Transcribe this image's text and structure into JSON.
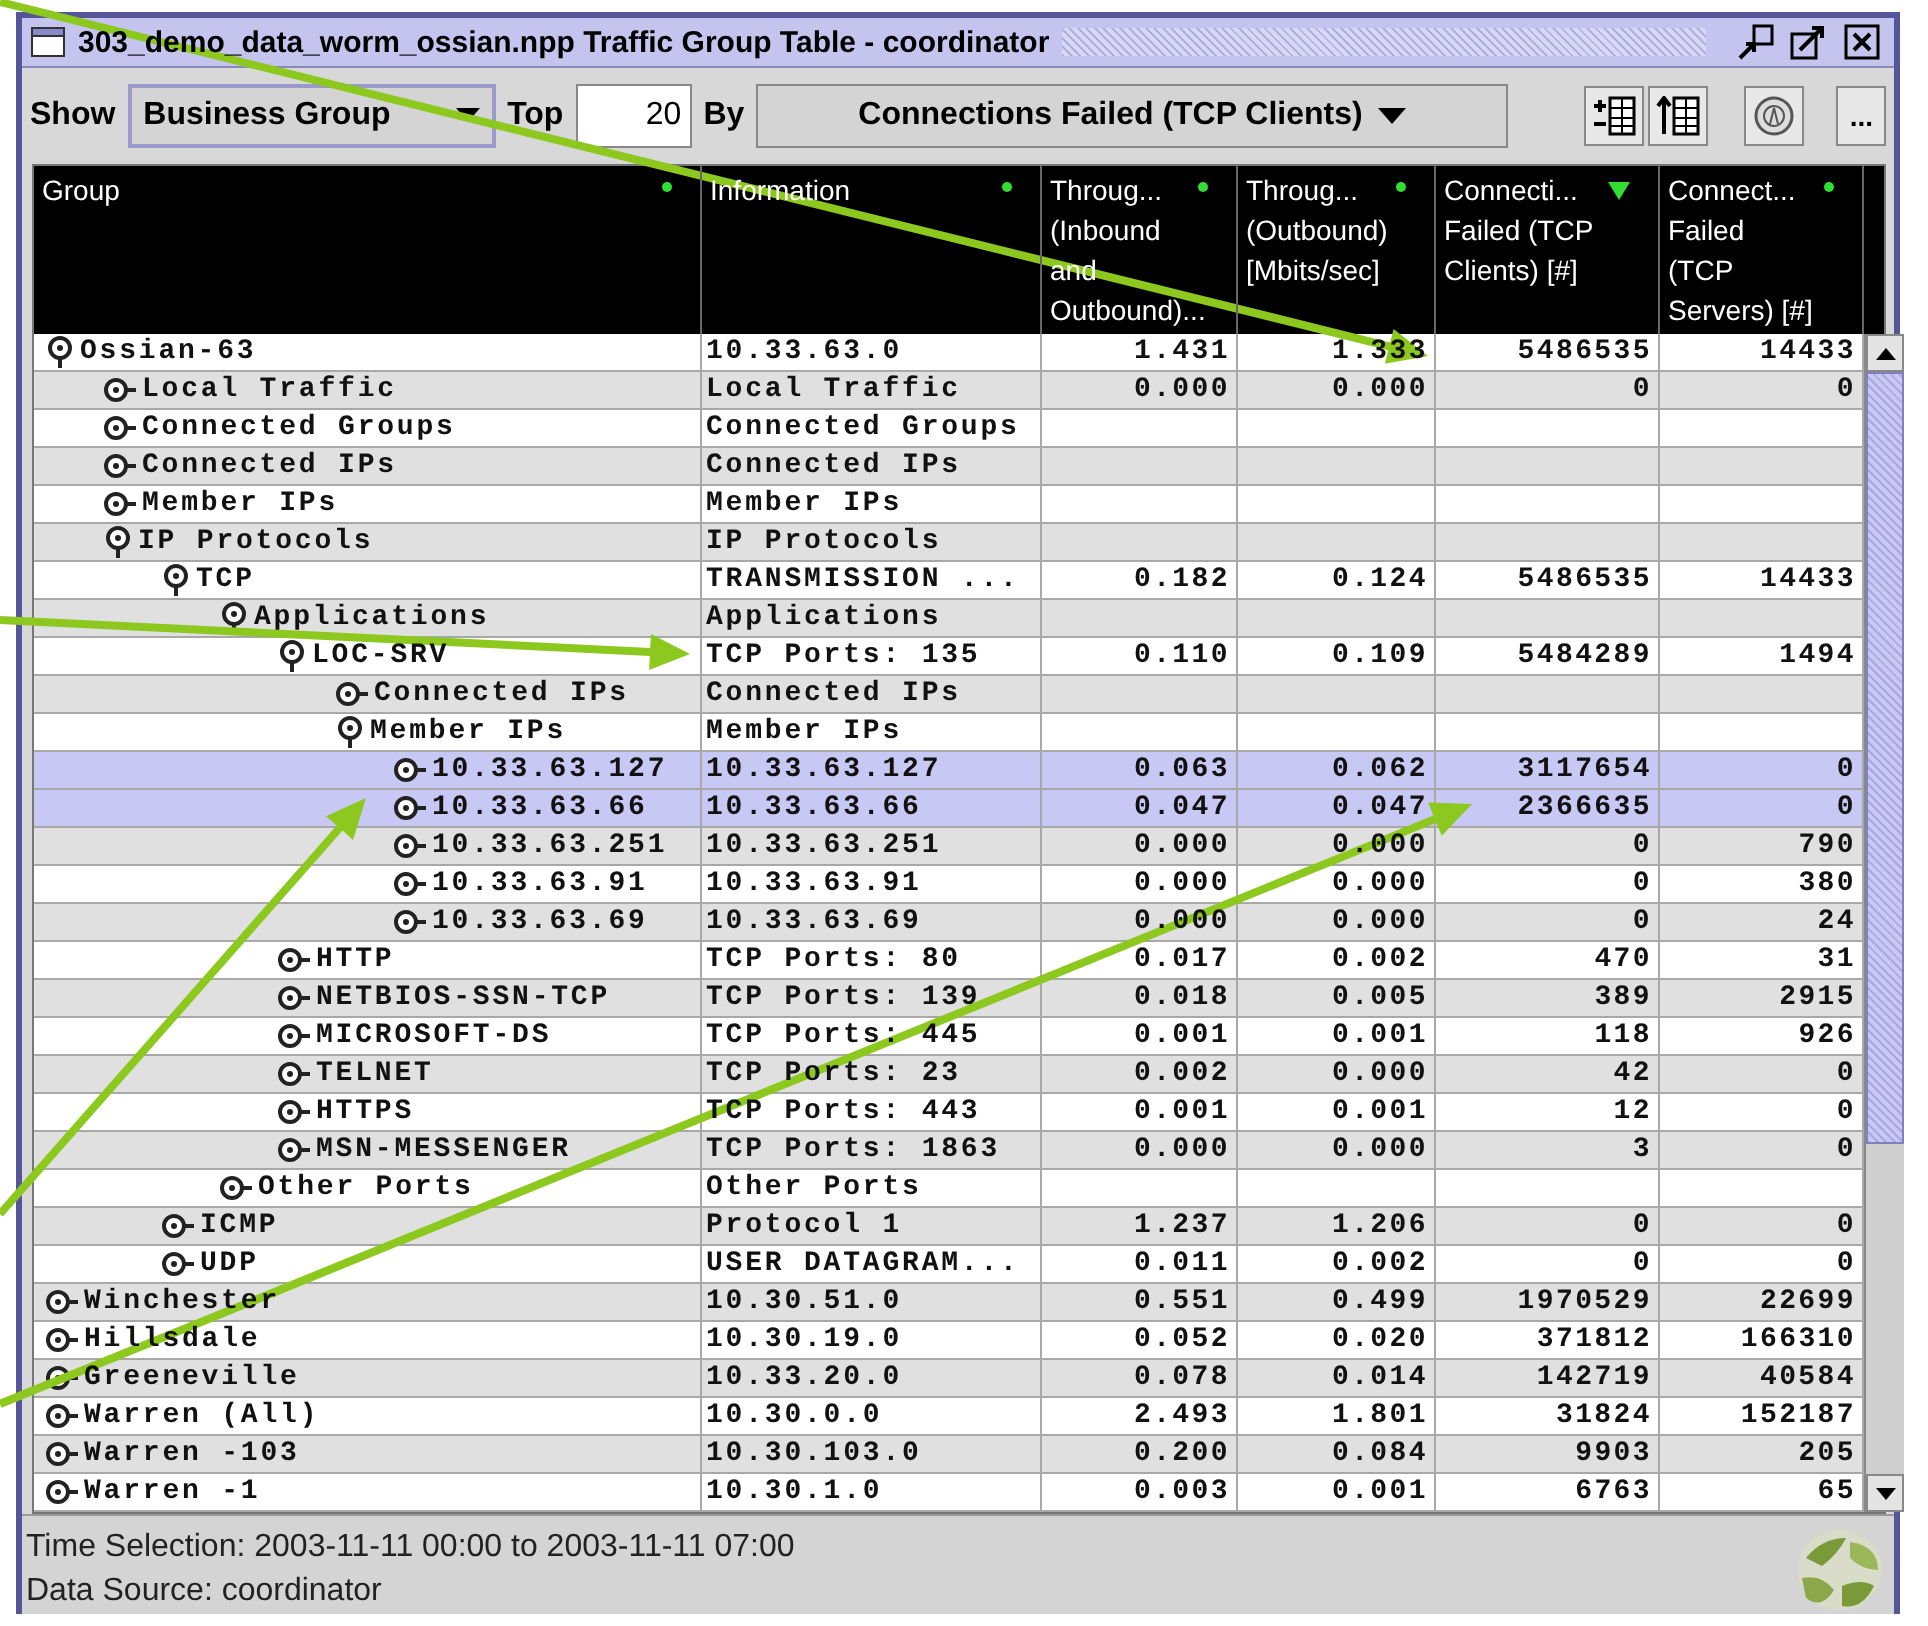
{
  "window": {
    "title": "303_demo_data_worm_ossian.npp Traffic Group Table - coordinator"
  },
  "toolbar": {
    "show_label": "Show",
    "show_value": "Business Group",
    "top_label": "Top",
    "top_value": "20",
    "by_label": "By",
    "by_value": "Connections Failed (TCP Clients)",
    "more_button": "..."
  },
  "table": {
    "columns": [
      {
        "title": "Group",
        "sorted": false
      },
      {
        "title": "Information",
        "sorted": false
      },
      {
        "title": "Throug...\n(Inbound\nand\nOutbound)...",
        "sorted": false
      },
      {
        "title": "Throug...\n(Outbound)\n[Mbits/sec]",
        "sorted": false
      },
      {
        "title": "Connecti...\nFailed (TCP\nClients) [#]",
        "sorted": true
      },
      {
        "title": "Connect...\nFailed\n(TCP\nServers) [#]",
        "sorted": false
      }
    ],
    "rows": [
      {
        "name": "Ossian-63",
        "info": "10.33.63.0",
        "values": [
          "1.431",
          "1.333",
          "5486535",
          "14433"
        ],
        "expanded": true,
        "selected": false,
        "children": [
          {
            "name": "Local Traffic",
            "info": "Local Traffic",
            "values": [
              "0.000",
              "0.000",
              "0",
              "0"
            ],
            "expanded": false,
            "selected": false
          },
          {
            "name": "Connected Groups",
            "info": "Connected Groups",
            "expanded": false,
            "selected": false
          },
          {
            "name": "Connected IPs",
            "info": "Connected IPs",
            "expanded": false,
            "selected": false
          },
          {
            "name": "Member IPs",
            "info": "Member IPs",
            "expanded": false,
            "selected": false
          },
          {
            "name": "IP Protocols",
            "info": "IP Protocols",
            "expanded": true,
            "selected": false,
            "children": [
              {
                "name": "TCP",
                "info": "TRANSMISSION ...",
                "values": [
                  "0.182",
                  "0.124",
                  "5486535",
                  "14433"
                ],
                "expanded": true,
                "selected": false,
                "children": [
                  {
                    "name": "Applications",
                    "info": "Applications",
                    "expanded": true,
                    "selected": false,
                    "children": [
                      {
                        "name": "LOC-SRV",
                        "info": "TCP Ports: 135",
                        "values": [
                          "0.110",
                          "0.109",
                          "5484289",
                          "1494"
                        ],
                        "expanded": true,
                        "selected": false,
                        "children": [
                          {
                            "name": "Connected IPs",
                            "info": "Connected IPs",
                            "expanded": false,
                            "selected": false
                          },
                          {
                            "name": "Member IPs",
                            "info": "Member IPs",
                            "expanded": true,
                            "selected": false,
                            "children": [
                              {
                                "name": "10.33.63.127",
                                "info": "10.33.63.127",
                                "values": [
                                  "0.063",
                                  "0.062",
                                  "3117654",
                                  "0"
                                ],
                                "expanded": false,
                                "selected": true
                              },
                              {
                                "name": "10.33.63.66",
                                "info": "10.33.63.66",
                                "values": [
                                  "0.047",
                                  "0.047",
                                  "2366635",
                                  "0"
                                ],
                                "expanded": false,
                                "selected": true
                              },
                              {
                                "name": "10.33.63.251",
                                "info": "10.33.63.251",
                                "values": [
                                  "0.000",
                                  "0.000",
                                  "0",
                                  "790"
                                ],
                                "expanded": false,
                                "selected": false
                              },
                              {
                                "name": "10.33.63.91",
                                "info": "10.33.63.91",
                                "values": [
                                  "0.000",
                                  "0.000",
                                  "0",
                                  "380"
                                ],
                                "expanded": false,
                                "selected": false
                              },
                              {
                                "name": "10.33.63.69",
                                "info": "10.33.63.69",
                                "values": [
                                  "0.000",
                                  "0.000",
                                  "0",
                                  "24"
                                ],
                                "expanded": false,
                                "selected": false
                              }
                            ]
                          }
                        ]
                      },
                      {
                        "name": "HTTP",
                        "info": "TCP Ports: 80",
                        "values": [
                          "0.017",
                          "0.002",
                          "470",
                          "31"
                        ],
                        "expanded": false,
                        "selected": false
                      },
                      {
                        "name": "NETBIOS-SSN-TCP",
                        "info": "TCP Ports: 139",
                        "values": [
                          "0.018",
                          "0.005",
                          "389",
                          "2915"
                        ],
                        "expanded": false,
                        "selected": false
                      },
                      {
                        "name": "MICROSOFT-DS",
                        "info": "TCP Ports: 445",
                        "values": [
                          "0.001",
                          "0.001",
                          "118",
                          "926"
                        ],
                        "expanded": false,
                        "selected": false
                      },
                      {
                        "name": "TELNET",
                        "info": "TCP Ports: 23",
                        "values": [
                          "0.002",
                          "0.000",
                          "42",
                          "0"
                        ],
                        "expanded": false,
                        "selected": false
                      },
                      {
                        "name": "HTTPS",
                        "info": "TCP Ports: 443",
                        "values": [
                          "0.001",
                          "0.001",
                          "12",
                          "0"
                        ],
                        "expanded": false,
                        "selected": false
                      },
                      {
                        "name": "MSN-MESSENGER",
                        "info": "TCP Ports: 1863",
                        "values": [
                          "0.000",
                          "0.000",
                          "3",
                          "0"
                        ],
                        "expanded": false,
                        "selected": false
                      }
                    ]
                  },
                  {
                    "name": "Other Ports",
                    "info": "Other Ports",
                    "expanded": false,
                    "selected": false
                  }
                ]
              },
              {
                "name": "ICMP",
                "info": "Protocol 1",
                "values": [
                  "1.237",
                  "1.206",
                  "0",
                  "0"
                ],
                "expanded": false,
                "selected": false
              },
              {
                "name": "UDP",
                "info": "USER DATAGRAM...",
                "values": [
                  "0.011",
                  "0.002",
                  "0",
                  "0"
                ],
                "expanded": false,
                "selected": false
              }
            ]
          }
        ]
      },
      {
        "name": "Winchester",
        "info": "10.30.51.0",
        "values": [
          "0.551",
          "0.499",
          "1970529",
          "22699"
        ],
        "expanded": false,
        "selected": false
      },
      {
        "name": "Hillsdale",
        "info": "10.30.19.0",
        "values": [
          "0.052",
          "0.020",
          "371812",
          "166310"
        ],
        "expanded": false,
        "selected": false
      },
      {
        "name": "Greeneville",
        "info": "10.33.20.0",
        "values": [
          "0.078",
          "0.014",
          "142719",
          "40584"
        ],
        "expanded": false,
        "selected": false
      },
      {
        "name": "Warren (All)",
        "info": "10.30.0.0",
        "values": [
          "2.493",
          "1.801",
          "31824",
          "152187"
        ],
        "expanded": false,
        "selected": false
      },
      {
        "name": "Warren -103",
        "info": "10.30.103.0",
        "values": [
          "0.200",
          "0.084",
          "9903",
          "205"
        ],
        "expanded": false,
        "selected": false
      },
      {
        "name": "Warren -1",
        "info": "10.30.1.0",
        "values": [
          "0.003",
          "0.001",
          "6763",
          "65"
        ],
        "expanded": false,
        "selected": false
      }
    ]
  },
  "status_bar": {
    "lines": [
      "Time Selection: 2003-11-11 00:00 to 2003-11-11 07:00",
      "Data Source: coordinator"
    ]
  }
}
